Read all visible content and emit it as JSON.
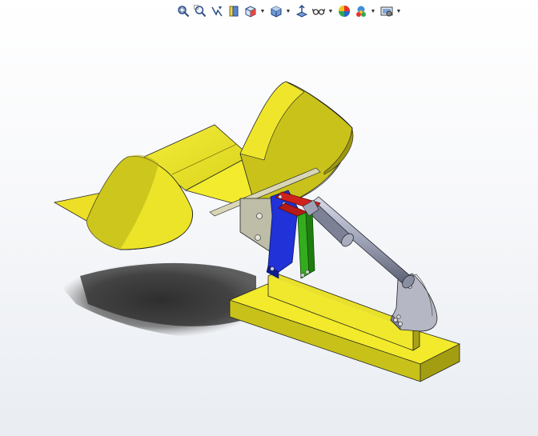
{
  "window": {
    "title": ""
  },
  "heads_up_toolbar": {
    "items": [
      {
        "id": "zoom-to-fit",
        "icon": "zoom-to-fit-icon",
        "dropdown": false
      },
      {
        "id": "zoom-to-area",
        "icon": "zoom-to-area-icon",
        "dropdown": false
      },
      {
        "id": "previous-view",
        "icon": "previous-view-icon",
        "dropdown": false
      },
      {
        "id": "section-view",
        "icon": "section-view-icon",
        "dropdown": false
      },
      {
        "id": "view-orientation",
        "icon": "view-orientation-icon",
        "dropdown": true
      },
      {
        "id": "display-style",
        "icon": "display-style-icon",
        "dropdown": true
      },
      {
        "id": "hide-show-items",
        "icon": "hide-show-items-icon",
        "dropdown": true
      },
      {
        "id": "edit-appearance",
        "icon": "edit-appearance-icon",
        "dropdown": true
      },
      {
        "id": "apply-scene",
        "icon": "apply-scene-icon",
        "dropdown": true
      },
      {
        "id": "view-settings",
        "icon": "view-settings-icon",
        "dropdown": true
      }
    ]
  },
  "model": {
    "name": "",
    "colors": {
      "bucket": "#f0e827",
      "bucket_shade": "#b8b21a",
      "bucket_dark": "#8a850f",
      "base": "#f0e827",
      "bracket": "#b9b9a6",
      "link_blue": "#1d2fd6",
      "link_green": "#2ea11a",
      "link_red": "#c8221e",
      "cylinder": "#9a9fb3",
      "shadow": "#3a3a3a"
    }
  }
}
